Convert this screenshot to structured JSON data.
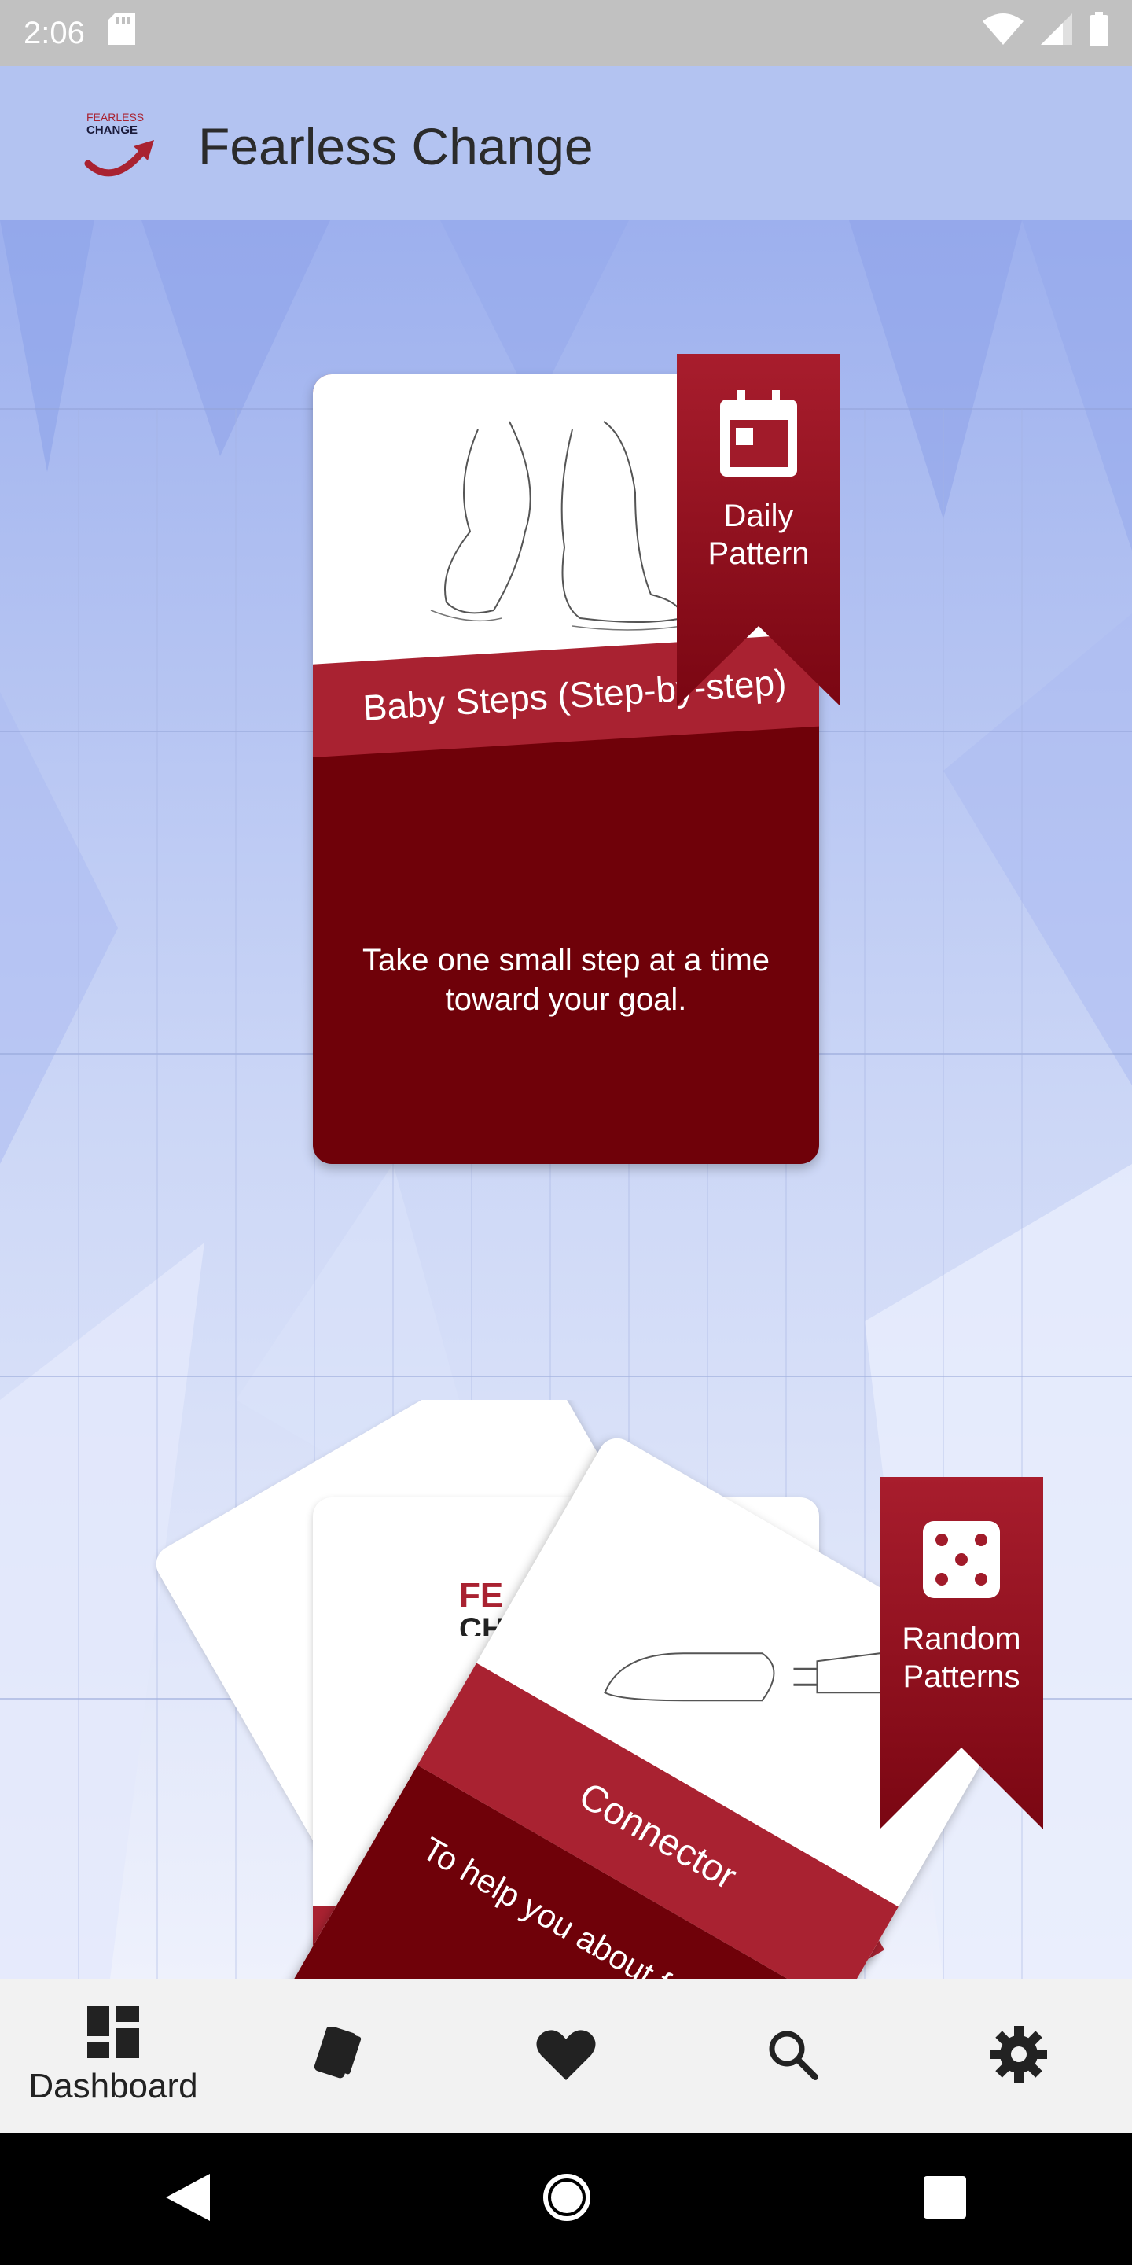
{
  "status_bar": {
    "time": "2:06",
    "icons": [
      "sd-card-icon",
      "wifi-icon",
      "signal-icon",
      "battery-icon"
    ]
  },
  "header": {
    "title": "Fearless Change",
    "logo_text_top": "FEARLESS",
    "logo_text_bottom": "CHANGE"
  },
  "daily": {
    "ribbon_label_line1": "Daily",
    "ribbon_label_line2": "Pattern",
    "ribbon_icon": "calendar-icon",
    "card_title": "Baby Steps (Step-by-step)",
    "card_description": "Take one small step at a time toward your goal."
  },
  "random": {
    "ribbon_label_line1": "Random",
    "ribbon_label_line2": "Patterns",
    "ribbon_icon": "dice-icon",
    "front_card_title": "Connector",
    "front_card_text": "To help you about f",
    "back_card_logo_line1": "FE",
    "back_card_logo_line2": "CH"
  },
  "bottom_nav": {
    "items": [
      {
        "label": "Dashboard",
        "icon": "dashboard-icon",
        "active": true
      },
      {
        "label": "",
        "icon": "cards-icon"
      },
      {
        "label": "",
        "icon": "heart-icon"
      },
      {
        "label": "",
        "icon": "search-icon"
      },
      {
        "label": "",
        "icon": "gear-icon"
      }
    ]
  },
  "colors": {
    "accent": "#a92231",
    "dark_red": "#6f0109",
    "header_bg": "#b3c3f1",
    "background": "#c9d6f6"
  }
}
